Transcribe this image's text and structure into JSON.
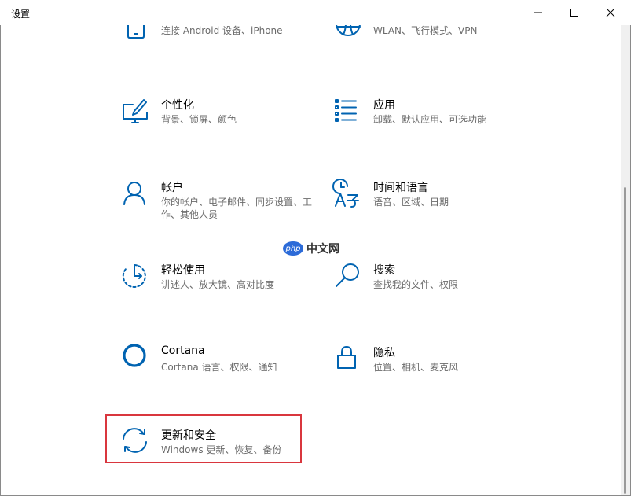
{
  "window": {
    "title": "设置"
  },
  "colors": {
    "accent": "#0063b1",
    "highlight": "#d9363e",
    "description": "#6b6b6b"
  },
  "tiles": [
    {
      "name": "",
      "desc": "连接 Android 设备、iPhone",
      "icon": "phone-icon"
    },
    {
      "name": "",
      "desc": "WLAN、飞行模式、VPN",
      "icon": "globe-icon"
    },
    {
      "name": "个性化",
      "desc": "背景、锁屏、颜色",
      "icon": "personalization-icon"
    },
    {
      "name": "应用",
      "desc": "卸载、默认应用、可选功能",
      "icon": "apps-list-icon"
    },
    {
      "name": "帐户",
      "desc": "你的帐户、电子邮件、同步设置、工作、其他人员",
      "icon": "person-icon"
    },
    {
      "name": "时间和语言",
      "desc": "语音、区域、日期",
      "icon": "time-language-icon"
    },
    {
      "name": "轻松使用",
      "desc": "讲述人、放大镜、高对比度",
      "icon": "ease-of-access-icon"
    },
    {
      "name": "搜索",
      "desc": "查找我的文件、权限",
      "icon": "search-icon"
    },
    {
      "name": "Cortana",
      "desc": "Cortana 语言、权限、通知",
      "icon": "cortana-icon"
    },
    {
      "name": "隐私",
      "desc": "位置、相机、麦克风",
      "icon": "lock-icon"
    },
    {
      "name": "更新和安全",
      "desc": "Windows 更新、恢复、备份",
      "icon": "update-icon"
    }
  ],
  "watermark": {
    "logo": "php",
    "text": "中文网"
  }
}
